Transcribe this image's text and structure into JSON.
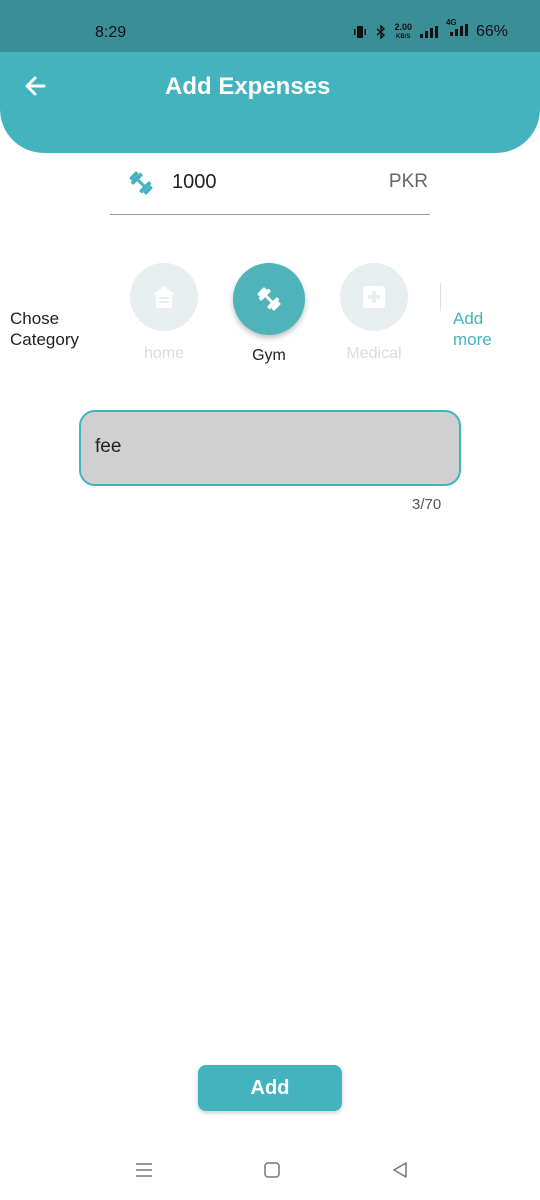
{
  "status_bar": {
    "time": "8:29",
    "net_speed_value": "2.00",
    "net_speed_unit": "KB/S",
    "network_type": "4G",
    "battery": "66%"
  },
  "header": {
    "title": "Add Expenses"
  },
  "amount": {
    "value": "1000",
    "currency": "PKR",
    "icon": "dumbbell-icon"
  },
  "category": {
    "label_line1": "Chose",
    "label_line2": "Category",
    "items": [
      {
        "name": "home",
        "icon": "home-icon",
        "selected": false
      },
      {
        "name": "Gym",
        "icon": "dumbbell-icon",
        "selected": true
      },
      {
        "name": "Medical",
        "icon": "medical-icon",
        "selected": false
      }
    ],
    "add_more_line1": "Add",
    "add_more_line2": "more"
  },
  "note": {
    "value": "fee",
    "counter": "3/70"
  },
  "actions": {
    "add_label": "Add"
  },
  "colors": {
    "accent": "#43b3be",
    "status_bar": "#3a8f97",
    "selected_category": "#4fb3b9",
    "note_background": "#d0d0d0"
  }
}
